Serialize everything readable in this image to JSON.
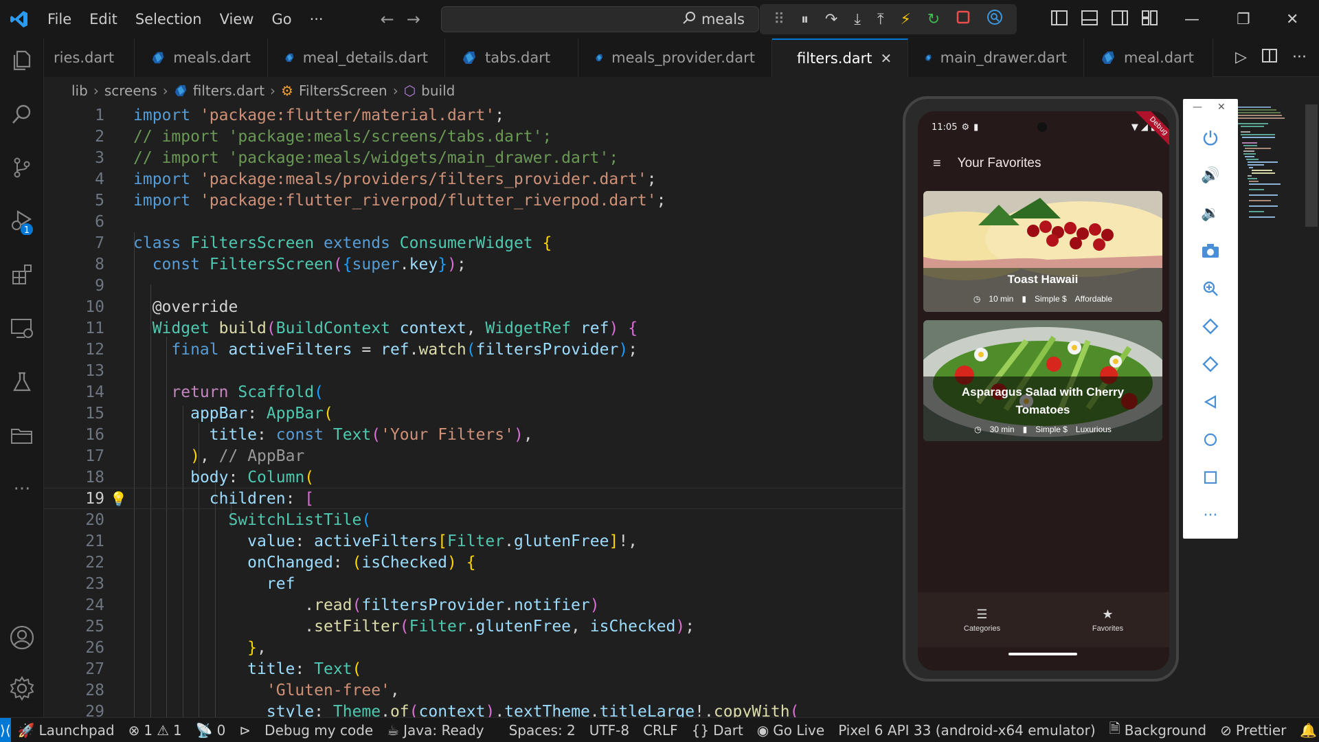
{
  "titlebar": {
    "menu": [
      "File",
      "Edit",
      "Selection",
      "View",
      "Go",
      "···"
    ],
    "command_center_text": "meals",
    "accent": "#0078d4"
  },
  "activity": {
    "debug_badge": "1"
  },
  "tabs": [
    {
      "label": "ries.dart",
      "active": false
    },
    {
      "label": "meals.dart",
      "active": false
    },
    {
      "label": "meal_details.dart",
      "active": false
    },
    {
      "label": "tabs.dart",
      "active": false
    },
    {
      "label": "meals_provider.dart",
      "active": false
    },
    {
      "label": "filters.dart",
      "active": true
    },
    {
      "label": "main_drawer.dart",
      "active": false
    },
    {
      "label": "meal.dart",
      "active": false
    }
  ],
  "breadcrumb": [
    "lib",
    "screens",
    "filters.dart",
    "FiltersScreen",
    "build"
  ],
  "code": {
    "current_line": 19,
    "lines": [
      {
        "n": "1"
      },
      {
        "n": "2"
      },
      {
        "n": "3"
      },
      {
        "n": "4"
      },
      {
        "n": "5"
      },
      {
        "n": "6"
      },
      {
        "n": "7"
      },
      {
        "n": "8"
      },
      {
        "n": "9"
      },
      {
        "n": "10"
      },
      {
        "n": "11"
      },
      {
        "n": "12"
      },
      {
        "n": "13"
      },
      {
        "n": "14"
      },
      {
        "n": "15"
      },
      {
        "n": "16"
      },
      {
        "n": "17"
      },
      {
        "n": "18"
      },
      {
        "n": "19"
      },
      {
        "n": "20"
      },
      {
        "n": "21"
      },
      {
        "n": "22"
      },
      {
        "n": "23"
      },
      {
        "n": "24"
      },
      {
        "n": "25"
      },
      {
        "n": "26"
      },
      {
        "n": "27"
      },
      {
        "n": "28"
      },
      {
        "n": "29"
      }
    ]
  },
  "phone": {
    "time": "11:05",
    "app_title": "Your Favorites",
    "debug_ribbon": "Debug",
    "meals": [
      {
        "title": "Toast Hawaii",
        "duration": "10 min",
        "complexity": "Simple $",
        "affordability": "Affordable"
      },
      {
        "title": "Asparagus Salad with Cherry Tomatoes",
        "duration": "30 min",
        "complexity": "Simple $",
        "affordability": "Luxurious"
      }
    ],
    "nav": [
      {
        "label": "Categories"
      },
      {
        "label": "Favorites"
      }
    ]
  },
  "statusbar": {
    "launchpad": "Launchpad",
    "errors": "1",
    "warnings": "1",
    "ports": "0",
    "debug_my_code": "Debug my code",
    "java": "Java: Ready",
    "spaces": "Spaces: 2",
    "encoding": "UTF-8",
    "eol": "CRLF",
    "language": "Dart",
    "go_live": "Go Live",
    "device": "Pixel 6 API 33 (android-x64 emulator)",
    "background": "Background",
    "prettier": "Prettier"
  }
}
